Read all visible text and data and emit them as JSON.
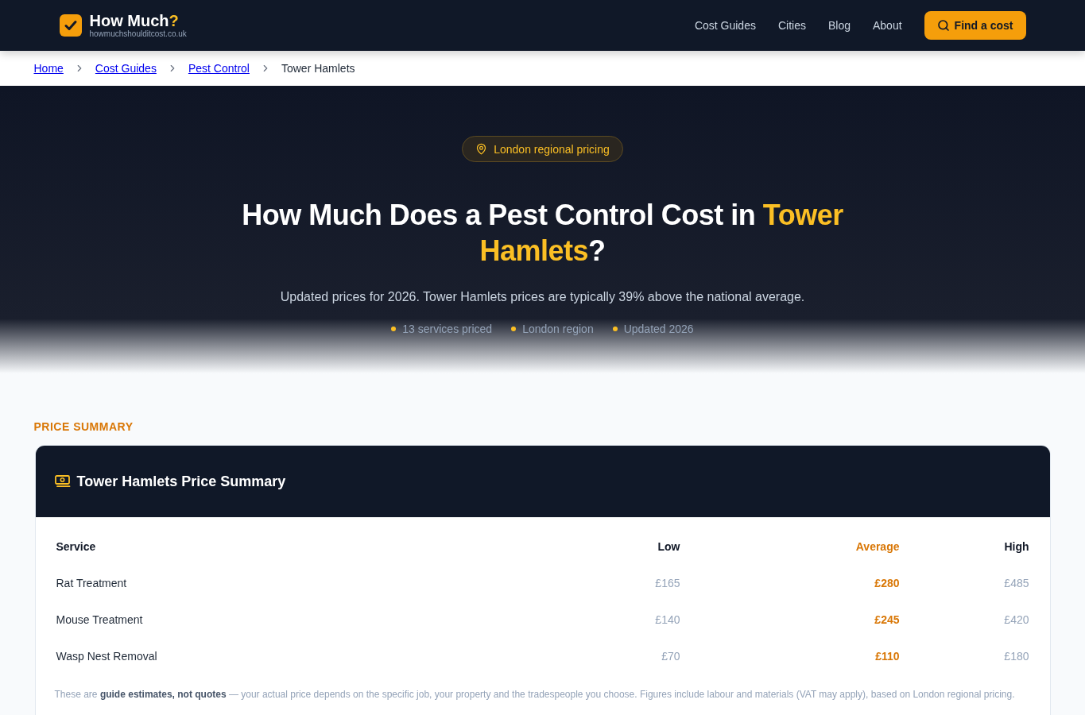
{
  "header": {
    "logo": {
      "name": "How Much",
      "mark": "?",
      "domain": "howmuchshoulditcost.co.uk"
    },
    "nav": [
      "Cost Guides",
      "Cities",
      "Blog",
      "About"
    ],
    "cta": "Find a cost"
  },
  "breadcrumb": [
    {
      "label": "Home",
      "kind": "link"
    },
    {
      "label": "Cost Guides",
      "kind": "link"
    },
    {
      "label": "Pest Control",
      "kind": "link"
    },
    {
      "label": "Tower Hamlets",
      "kind": "current"
    }
  ],
  "hero": {
    "badge": "London regional pricing",
    "title": {
      "before": "How Much Does a Pest Control Cost in",
      "highlight": "Tower Hamlets",
      "after": "?"
    },
    "subtitle": "Updated prices for 2026. Tower Hamlets prices are typically 39% above the national average.",
    "facts": [
      "13 services priced",
      "London region",
      "Updated 2026"
    ]
  },
  "price_summary": {
    "eyebrow": "PRICE SUMMARY",
    "title": "Tower Hamlets Price Summary",
    "columns": [
      {
        "label": "Service",
        "kind": "label"
      },
      {
        "label": "Low",
        "kind": "price"
      },
      {
        "label": "Average",
        "kind": "average"
      },
      {
        "label": "High",
        "kind": "price"
      }
    ],
    "rows": [
      {
        "cells": [
          "Rat Treatment",
          "£165",
          "£280",
          "£485"
        ]
      },
      {
        "cells": [
          "Mouse Treatment",
          "£140",
          "£245",
          "£420"
        ]
      },
      {
        "cells": [
          "Wasp Nest Removal",
          "£70",
          "£110",
          "£180"
        ]
      }
    ],
    "note": "These are **guide estimates, not quotes** — your actual price depends on the specific job, your property and the tradespeople you choose. Figures include labour and materials (VAT may apply), based on London regional pricing."
  }
}
